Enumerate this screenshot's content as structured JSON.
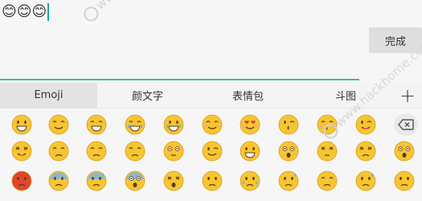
{
  "input": {
    "text": "😊😊😊"
  },
  "toolbar": {
    "done_label": "完成"
  },
  "tabs": [
    {
      "label": "Emoji",
      "active": true
    },
    {
      "label": "颜文字",
      "active": false
    },
    {
      "label": "表情包",
      "active": false
    },
    {
      "label": "斗图",
      "active": false
    }
  ],
  "watermark": {
    "text": "www.hackhome.com"
  },
  "colors": {
    "accent": "#43b7ae",
    "face_yellow": "#f7c531",
    "face_angry": "#e2452b",
    "face_blue": "#7fb3e0"
  },
  "emoji_grid": [
    [
      "grinning-face",
      "smiling-face",
      "beaming-face",
      "tears-of-joy",
      "loudly-crying",
      "smiling-blushing",
      "heart-eyes",
      "kissing-wink",
      "kissing-closed-eyes",
      "winking-tongue"
    ],
    [
      "squinting-tongue",
      "disappointed",
      "unamused",
      "pensive",
      "flushed",
      "winking-face",
      "grimacing",
      "astonished",
      "dizzy-face",
      "confounded",
      "surprised"
    ],
    [
      "angry-face",
      "fearful-face",
      "anxious-sweat",
      "screaming-fear",
      "tired-face",
      "weary-face",
      "crying-face",
      "downcast-sweat",
      "sleepy-face",
      "sweat-face",
      "frowning"
    ]
  ]
}
